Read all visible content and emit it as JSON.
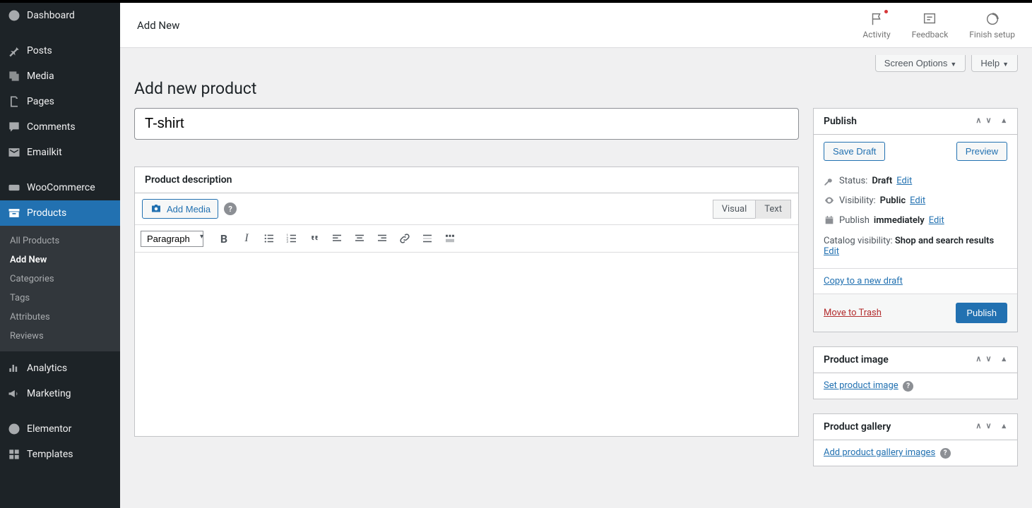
{
  "sidebar": {
    "items": [
      {
        "label": "Dashboard"
      },
      {
        "label": "Posts"
      },
      {
        "label": "Media"
      },
      {
        "label": "Pages"
      },
      {
        "label": "Comments"
      },
      {
        "label": "Emailkit"
      },
      {
        "label": "WooCommerce"
      },
      {
        "label": "Products"
      },
      {
        "label": "Analytics"
      },
      {
        "label": "Marketing"
      },
      {
        "label": "Elementor"
      },
      {
        "label": "Templates"
      }
    ],
    "products_sub": [
      {
        "label": "All Products"
      },
      {
        "label": "Add New"
      },
      {
        "label": "Categories"
      },
      {
        "label": "Tags"
      },
      {
        "label": "Attributes"
      },
      {
        "label": "Reviews"
      }
    ]
  },
  "topbar": {
    "breadcrumb": "Add New",
    "actions": {
      "activity": "Activity",
      "feedback": "Feedback",
      "finish": "Finish setup"
    }
  },
  "screen": {
    "options": "Screen Options",
    "help": "Help"
  },
  "page": {
    "title": "Add new product"
  },
  "product": {
    "title_value": "T-shirt"
  },
  "editor": {
    "box_title": "Product description",
    "add_media": "Add Media",
    "tab_visual": "Visual",
    "tab_text": "Text",
    "format_select": "Paragraph"
  },
  "publish_box": {
    "title": "Publish",
    "save_draft": "Save Draft",
    "preview": "Preview",
    "status_label": "Status:",
    "status_value": "Draft",
    "visibility_label": "Visibility:",
    "visibility_value": "Public",
    "schedule_label": "Publish",
    "schedule_value": "immediately",
    "catalog_label": "Catalog visibility:",
    "catalog_value": "Shop and search results",
    "edit": "Edit",
    "copy": "Copy to a new draft",
    "trash": "Move to Trash",
    "publish": "Publish"
  },
  "image_box": {
    "title": "Product image",
    "link": "Set product image"
  },
  "gallery_box": {
    "title": "Product gallery",
    "link": "Add product gallery images"
  }
}
